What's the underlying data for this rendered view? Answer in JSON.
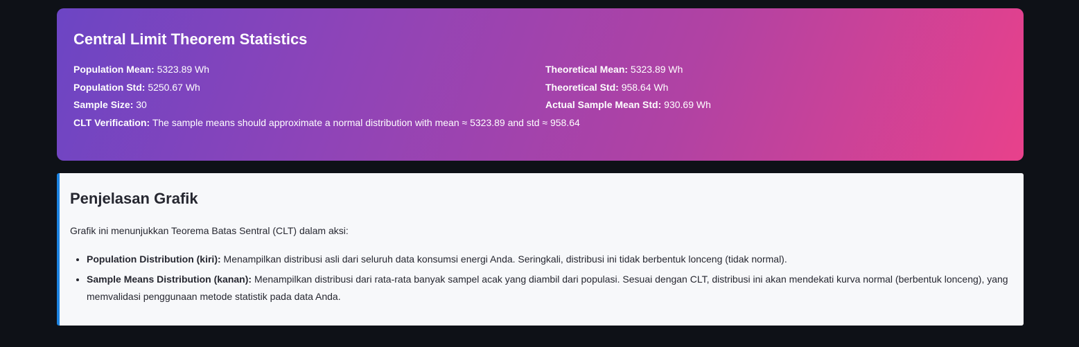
{
  "stats": {
    "title": "Central Limit Theorem Statistics",
    "population_mean_label": "Population Mean:",
    "population_mean_value": "5323.89 Wh",
    "theoretical_mean_label": "Theoretical Mean:",
    "theoretical_mean_value": "5323.89 Wh",
    "population_std_label": "Population Std:",
    "population_std_value": "5250.67 Wh",
    "theoretical_std_label": "Theoretical Std:",
    "theoretical_std_value": "958.64 Wh",
    "sample_size_label": "Sample Size:",
    "sample_size_value": "30",
    "actual_sample_mean_std_label": "Actual Sample Mean Std:",
    "actual_sample_mean_std_value": "930.69 Wh",
    "clt_label": "CLT Verification:",
    "clt_value": "The sample means should approximate a normal distribution with mean ≈ 5323.89 and std ≈ 958.64",
    "gradient_start": "#6c45c4",
    "gradient_end": "#e8418b"
  },
  "explanation": {
    "title": "Penjelasan Grafik",
    "intro": "Grafik ini menunjukkan Teorema Batas Sentral (CLT) dalam aksi:",
    "items": [
      {
        "label": "Population Distribution (kiri):",
        "text": "Menampilkan distribusi asli dari seluruh data konsumsi energi Anda. Seringkali, distribusi ini tidak berbentuk lonceng (tidak normal)."
      },
      {
        "label": "Sample Means Distribution (kanan):",
        "text": "Menampilkan distribusi dari rata-rata banyak sampel acak yang diambil dari populasi. Sesuai dengan CLT, distribusi ini akan mendekati kurva normal (berbentuk lonceng), yang memvalidasi penggunaan metode statistik pada data Anda."
      }
    ],
    "accent_color": "#1c83e1"
  }
}
